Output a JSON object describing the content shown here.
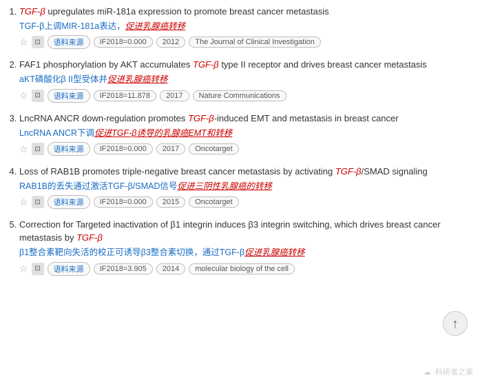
{
  "results": [
    {
      "id": 1,
      "title_parts": [
        {
          "text": "TGF-β",
          "type": "tgfb"
        },
        {
          "text": " upregulates miR-181a expression to promote breast cancer metastasis",
          "type": "normal"
        }
      ],
      "subtitle": "TGF-β上调MIR-181a表达，",
      "subtitle_emphasis": "促进乳腺癌转移",
      "subtitle_emphasis_plain": false,
      "meta_source_label": "语料来源",
      "meta_if": "IF2018=0.000",
      "meta_year": "2012",
      "meta_journal": "The Journal of Clinical Investigation"
    },
    {
      "id": 2,
      "title_parts": [
        {
          "text": "FAF1 phosphorylation by AKT accumulates ",
          "type": "normal"
        },
        {
          "text": "TGF-β",
          "type": "tgfb"
        },
        {
          "text": " type II receptor and drives breast cancer metastasis",
          "type": "normal"
        }
      ],
      "subtitle": "aKT磷酸化β II型受体并",
      "subtitle_emphasis": "促进乳腺癌转移",
      "meta_source_label": "语料来源",
      "meta_if": "IF2018=11.878",
      "meta_year": "2017",
      "meta_journal": "Nature Communications"
    },
    {
      "id": 3,
      "title_parts": [
        {
          "text": "LncRNA ANCR down-regulation promotes ",
          "type": "normal"
        },
        {
          "text": "TGF-β",
          "type": "tgfb"
        },
        {
          "text": "-induced EMT and metastasis in breast cancer",
          "type": "normal"
        }
      ],
      "subtitle": "LncRNA ANCR下调",
      "subtitle_emphasis": "促进TGF-β诱导的乳腺癌EMT和转移",
      "meta_source_label": "语料来源",
      "meta_if": "IF2018=0.000",
      "meta_year": "2017",
      "meta_journal": "Oncotarget"
    },
    {
      "id": 4,
      "title_parts": [
        {
          "text": "Loss of RAB1B promotes triple-negative breast cancer metastasis by activating ",
          "type": "normal"
        },
        {
          "text": "TGF-β",
          "type": "tgfb"
        },
        {
          "text": "/SMAD signaling",
          "type": "normal"
        }
      ],
      "subtitle": "RAB1B的丢失通过激活TGF-β/SMAD信号",
      "subtitle_emphasis": "促进三阴性乳腺癌的转移",
      "meta_source_label": "语料来源",
      "meta_if": "IF2018=0.000",
      "meta_year": "2015",
      "meta_journal": "Oncotarget"
    },
    {
      "id": 5,
      "title_parts": [
        {
          "text": "Correction for Targeted inactivation of β1 integrin induces β3 integrin switching, which drives breast cancer metastasis by ",
          "type": "normal"
        },
        {
          "text": "TGF-β",
          "type": "tgfb"
        }
      ],
      "subtitle": "β1整合素靶向失活的校正可诱导β3整合素切换，通过TGF-β",
      "subtitle_emphasis": "促进乳腺癌转移",
      "meta_source_label": "语料来源",
      "meta_if": "IF2018=3.905",
      "meta_year": "2014",
      "meta_journal": "molecular biology of the cell"
    }
  ],
  "scroll_up_label": "↑",
  "watermark_text": "科研者之家"
}
